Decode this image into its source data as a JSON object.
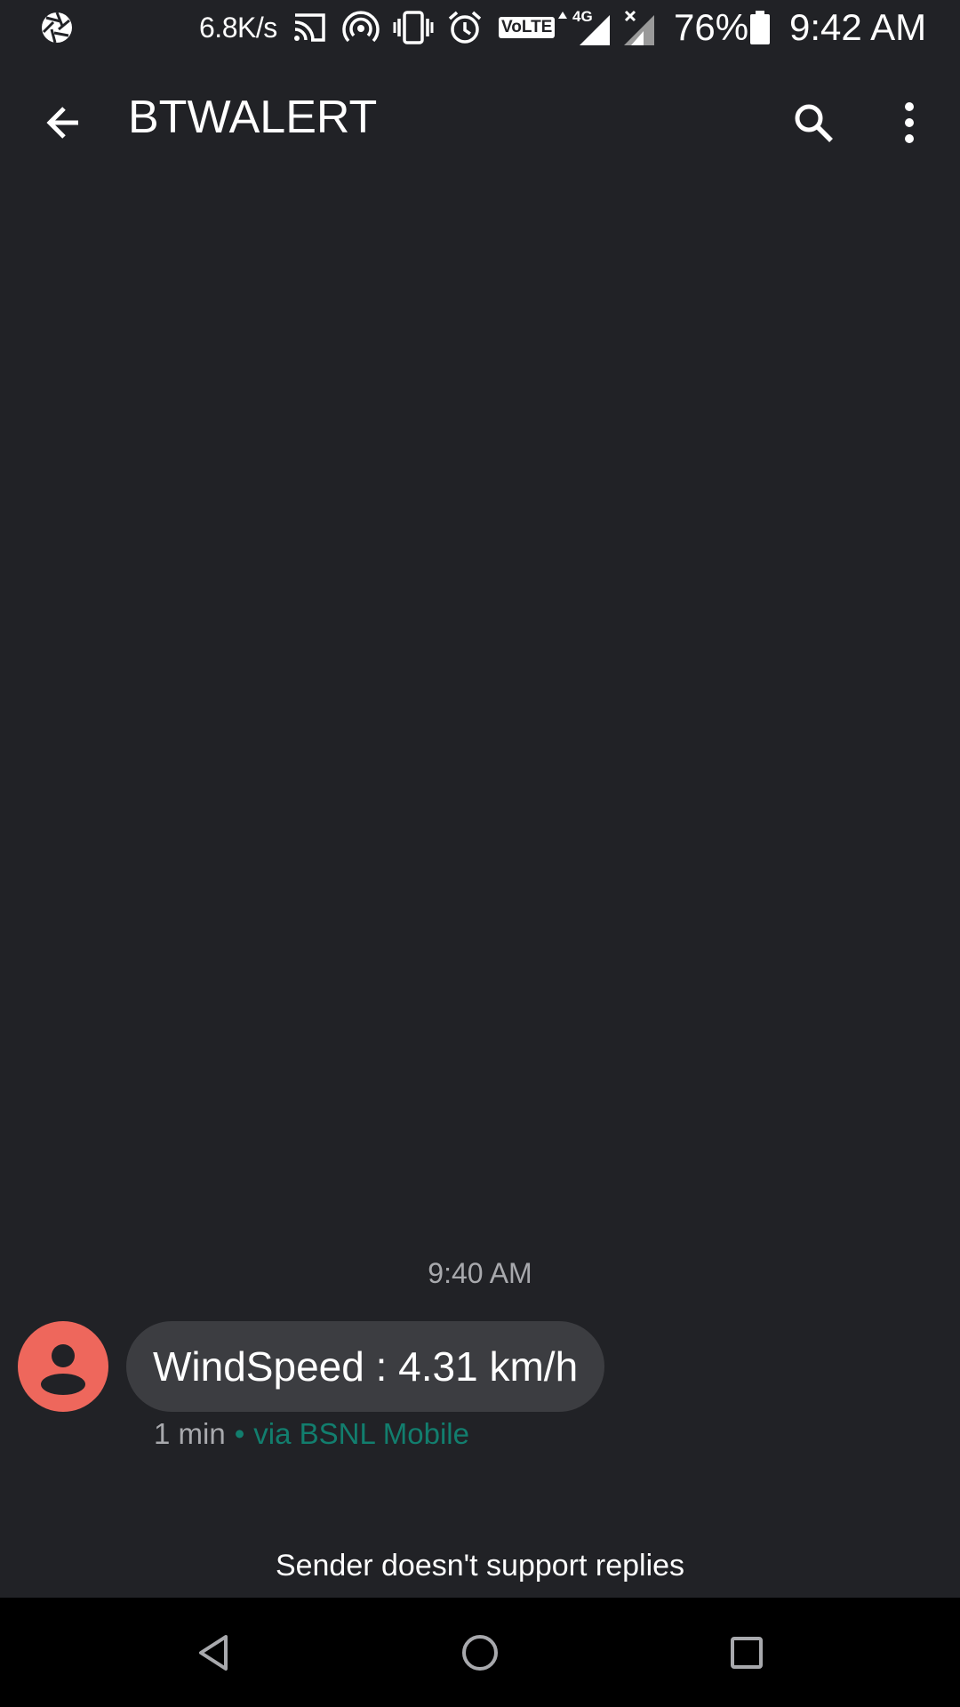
{
  "status_bar": {
    "net_speed": "6.8K/s",
    "network_badge": "VoLTE",
    "network_type": "4G",
    "battery": "76%",
    "time": "9:42 AM",
    "icons": [
      "aperture-icon",
      "cast-icon",
      "hotspot-icon",
      "vibrate-icon",
      "alarm-icon",
      "volte-icon",
      "signal-icon",
      "no-signal-icon",
      "battery-icon"
    ]
  },
  "app_bar": {
    "title": "BTWALERT"
  },
  "conversation": {
    "timestamp": "9:40 AM",
    "message": {
      "text": "WindSpeed : 4.31 km/h",
      "time_ago": "1 min",
      "separator": "•",
      "via": "via BSNL Mobile"
    },
    "footer_note": "Sender doesn't support replies"
  },
  "colors": {
    "background": "#212226",
    "bubble": "#3c3d41",
    "avatar": "#ee675c",
    "accent": "#127e6e",
    "secondary_text": "#a8a9ad"
  }
}
